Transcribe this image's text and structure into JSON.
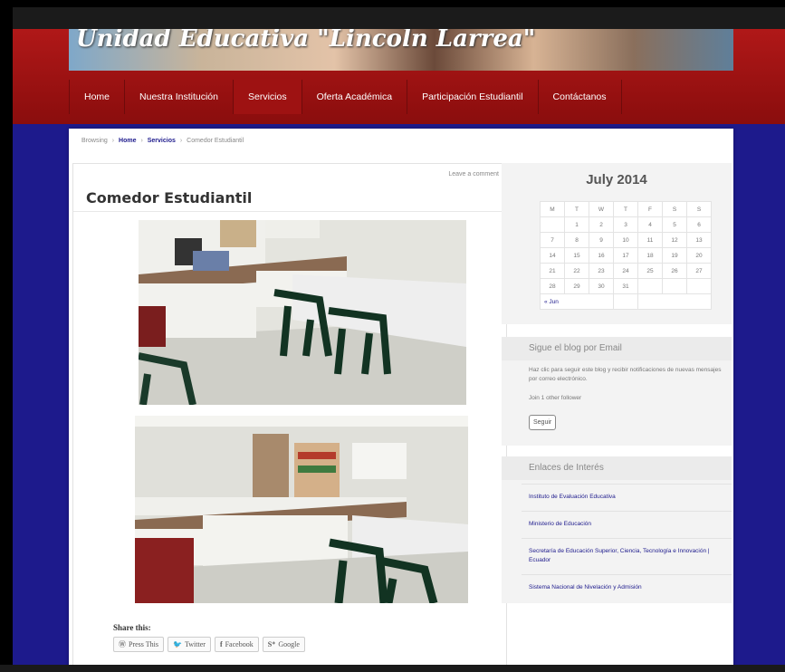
{
  "site": {
    "title": "Unidad Educativa \"Lincoln Larrea\""
  },
  "nav": {
    "items": [
      "Home",
      "Nuestra Institución",
      "Servicios",
      "Oferta Académica",
      "Participación Estudiantil",
      "Contáctanos"
    ],
    "active_index": 2
  },
  "breadcrumb": {
    "prefix": "Browsing",
    "items": [
      "Home",
      "Servicios",
      "Comedor Estudiantil"
    ]
  },
  "post": {
    "meta": "Leave a comment",
    "title": "Comedor Estudiantil"
  },
  "share": {
    "title": "Share this:",
    "buttons": [
      "Press This",
      "Twitter",
      "Facebook",
      "Google"
    ]
  },
  "calendar": {
    "title": "July 2014",
    "headers": [
      "M",
      "T",
      "W",
      "T",
      "F",
      "S",
      "S"
    ],
    "rows": [
      [
        "",
        "1",
        "2",
        "3",
        "4",
        "5",
        "6"
      ],
      [
        "7",
        "8",
        "9",
        "10",
        "11",
        "12",
        "13"
      ],
      [
        "14",
        "15",
        "16",
        "17",
        "18",
        "19",
        "20"
      ],
      [
        "21",
        "22",
        "23",
        "24",
        "25",
        "26",
        "27"
      ],
      [
        "28",
        "29",
        "30",
        "31",
        "",
        "",
        ""
      ]
    ],
    "prev": "« Jun"
  },
  "follow": {
    "title": "Sigue el blog por Email",
    "text": "Haz clic para seguir este blog y recibir notificaciones de nuevas mensajes por correo electrónico.",
    "join": "Join 1 other follower",
    "button": "Seguir"
  },
  "links_widget": {
    "title": "Enlaces de Interés",
    "items": [
      "Instituto de Evaluación Educativa",
      "Ministerio de Educación",
      "Secretaría de Educación Superior, Ciencia, Tecnología e Innovación | Ecuador",
      "Sistema Nacional de Nivelación y Admisión"
    ]
  }
}
